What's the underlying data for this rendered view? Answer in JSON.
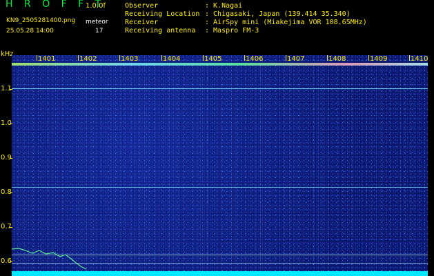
{
  "header": {
    "app_title": "H R O F F T",
    "version": "1.0.0f",
    "filename": "KN9_2505281400.png",
    "datetime": "25.05.28 14:00",
    "meteor_label": "meteor",
    "meteor_count": "17",
    "info": [
      {
        "label": "Observer",
        "value": ": K.Nagai"
      },
      {
        "label": "Receiving Location",
        "value": ": Chigasaki, Japan (139.414 35.340)"
      },
      {
        "label": "Receiver",
        "value": ": AirSpy mini (Miakejima VOR 108.65MHz)"
      },
      {
        "label": "Receiving antenna",
        "value": ": Maspro FM-3"
      }
    ]
  },
  "plot": {
    "y_unit": "kHz",
    "y_ticks": [
      "1.1",
      "1.0",
      "0.9",
      "0.8",
      "0.7",
      "0.6"
    ],
    "x_ticks": [
      "1401",
      "1402",
      "1403",
      "1404",
      "1405",
      "1406",
      "1407",
      "1408",
      "1409",
      "1410"
    ],
    "colors": {
      "background": "#000000",
      "label": "#ffee00",
      "title": "#00ee44",
      "band": "#00e8ff"
    }
  }
}
